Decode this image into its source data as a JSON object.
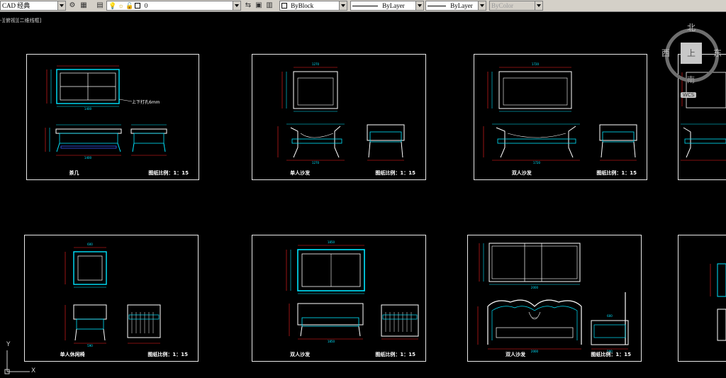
{
  "toolbar": {
    "workspace": "CAD 经典",
    "layer": "0",
    "color_control": "ByBlock",
    "linetype_control": "ByLayer",
    "lineweight_control": "ByLayer",
    "plotstyle_control": "ByColor",
    "icons": [
      "gear-icon",
      "workspace-settings-icon",
      "layer-manager-icon",
      "bulb-icon",
      "sun-icon",
      "lock-icon",
      "color-square-icon",
      "layer-prev-icon",
      "layer-state-icon",
      "match-layer-icon"
    ]
  },
  "viewport": {
    "label": "-][俯视][二维线框]"
  },
  "viewcube": {
    "north": "北",
    "west": "西",
    "east": "东",
    "south": "南",
    "top": "上",
    "wcs": "WCS"
  },
  "colors": {
    "frame": "#e8e8e8",
    "cyan": "#00e5ff",
    "red": "#ff2020",
    "blue": "#3a5cff",
    "white": "#ffffff"
  },
  "dims": {
    "coffee_top_width": "1400",
    "coffee_bottom": "1400",
    "coffee_note": "上下打孔6mm",
    "single_top": "1270",
    "single_front": "1270",
    "double_top": "1720",
    "double_front": "1720",
    "stool_top": "600",
    "stool_front": "590",
    "double2_top": "1850",
    "double2_front": "1850",
    "bed_top": "2000",
    "bed_front": "2000",
    "side_front": "590",
    "side_front2": "600"
  },
  "frames": [
    {
      "title": "茶几",
      "scale": "图纸比例：1：15"
    },
    {
      "title": "单人沙发",
      "scale": "图纸比例：1：15"
    },
    {
      "title": "双人沙发",
      "scale": "图纸比例：1：15"
    },
    {
      "title": "单人休闲椅",
      "scale": "图纸比例：1：15"
    },
    {
      "title": "双人沙发",
      "scale": "图纸比例：1：15"
    },
    {
      "title": "双人沙发",
      "scale": "图纸比例：1：15"
    }
  ],
  "ucs": {
    "x": "X",
    "y": "Y"
  }
}
